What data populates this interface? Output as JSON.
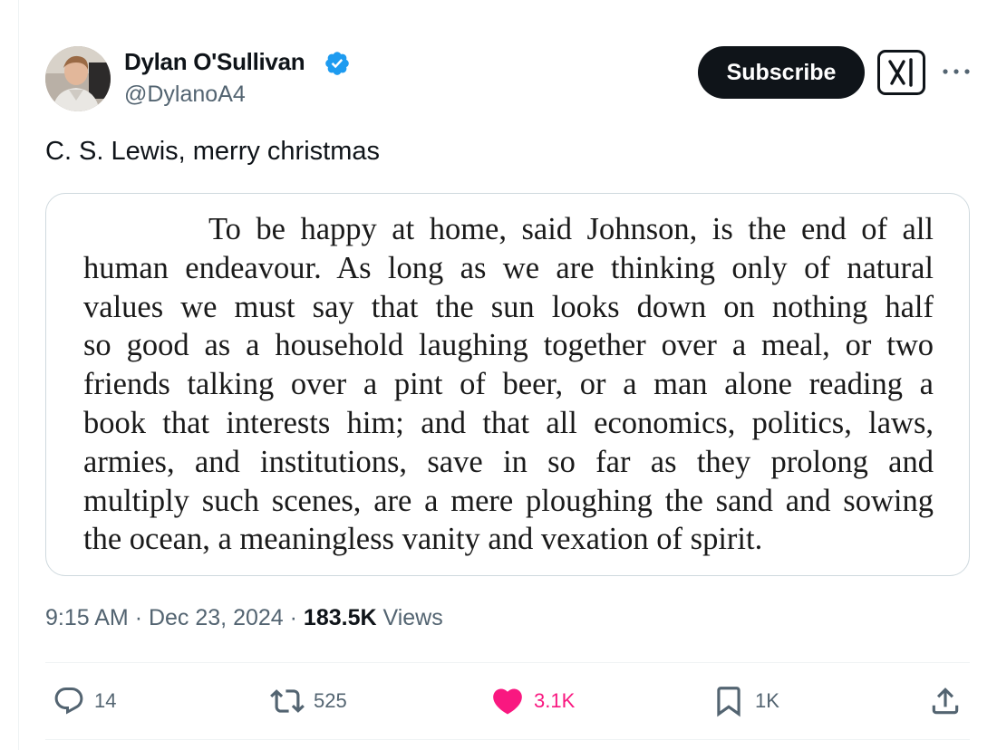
{
  "author": {
    "display_name": "Dylan O'Sullivan",
    "handle": "@DylanoA4",
    "verified_icon": "verified-badge-icon",
    "avatar": "profile-photo"
  },
  "header": {
    "subscribe_label": "Subscribe",
    "grok_icon": "grok-icon",
    "more_icon": "more-dots-icon"
  },
  "tweet": {
    "text": "C. S. Lewis, merry christmas",
    "image_quote_lines": [
      "To be happy at home, said Johnson, is the end of all",
      "human endeavour. As long as we are thinking only of natural",
      "values we must say that the sun looks down on nothing half",
      "so good as a household laughing together over a meal, or two",
      "friends talking over a pint of beer, or a man alone reading a",
      "book that interests him; and that all economics, politics, laws,",
      "armies, and institutions, save in so far as they prolong and",
      "multiply such scenes, are a mere ploughing the sand and sowing",
      "the ocean, a meaningless vanity and vexation of spirit."
    ]
  },
  "meta": {
    "time": "9:15 AM",
    "separator": "·",
    "date": "Dec 23, 2024",
    "views_count": "183.5K",
    "views_label": "Views"
  },
  "actions": {
    "replies": "14",
    "reposts": "525",
    "likes": "3.1K",
    "bookmarks": "1K",
    "icons": [
      "reply-icon",
      "repost-icon",
      "like-icon",
      "bookmark-icon",
      "share-icon"
    ]
  },
  "colors": {
    "text": "#0f1419",
    "secondary": "#536471",
    "like": "#f91880",
    "verified": "#1d9bf0",
    "border": "#cfd9de"
  }
}
